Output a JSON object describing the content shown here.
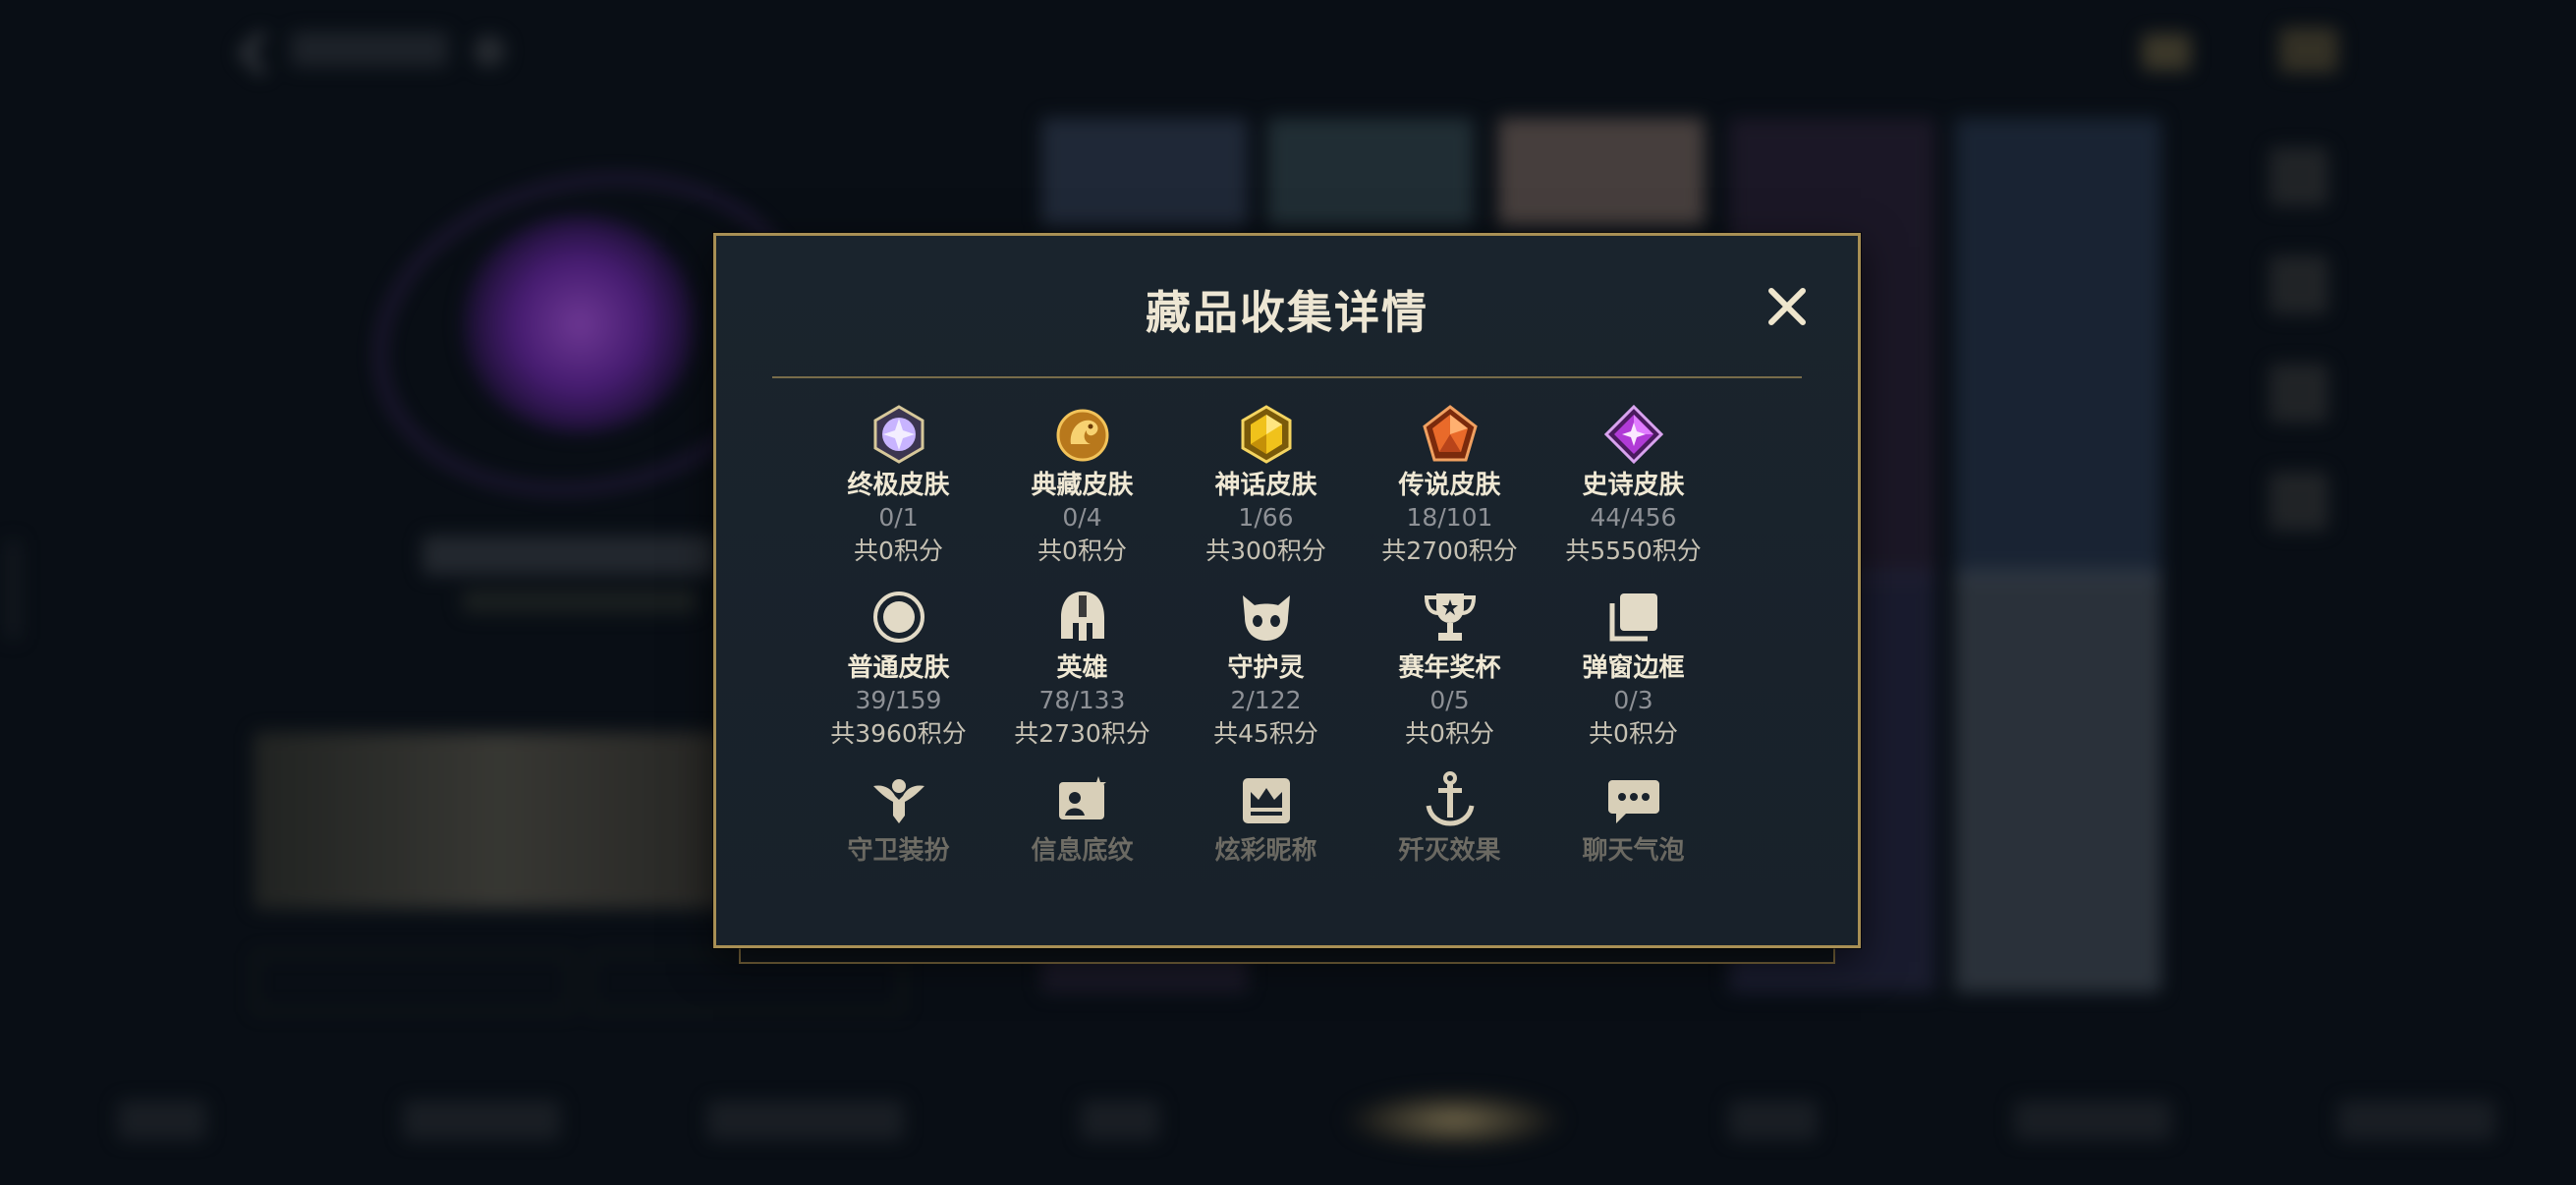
{
  "dialog": {
    "title": "藏品收集详情",
    "close_label": "✕"
  },
  "categories": [
    {
      "name": "终极皮肤",
      "count": "0/1",
      "points": "共0积分",
      "icon": "ultimate-skin-icon",
      "color": "#c8b4ff"
    },
    {
      "name": "典藏皮肤",
      "count": "0/4",
      "points": "共0积分",
      "icon": "collector-skin-icon",
      "color": "#e0a33a"
    },
    {
      "name": "神话皮肤",
      "count": "1/66",
      "points": "共300积分",
      "icon": "mythic-skin-icon",
      "color": "#f0c21b"
    },
    {
      "name": "传说皮肤",
      "count": "18/101",
      "points": "共2700积分",
      "icon": "legendary-skin-icon",
      "color": "#e96a2a"
    },
    {
      "name": "史诗皮肤",
      "count": "44/456",
      "points": "共5550积分",
      "icon": "epic-skin-icon",
      "color": "#b03ad6"
    },
    {
      "name": "普通皮肤",
      "count": "39/159",
      "points": "共3960积分",
      "icon": "normal-skin-icon",
      "color": "#d8cfb8"
    },
    {
      "name": "英雄",
      "count": "78/133",
      "points": "共2730积分",
      "icon": "hero-helmet-icon",
      "color": "#d8cfb8"
    },
    {
      "name": "守护灵",
      "count": "2/122",
      "points": "共45积分",
      "icon": "guardian-spirit-icon",
      "color": "#d8cfb8"
    },
    {
      "name": "赛年奖杯",
      "count": "0/5",
      "points": "共0积分",
      "icon": "trophy-icon",
      "color": "#d8cfb8"
    },
    {
      "name": "弹窗边框",
      "count": "0/3",
      "points": "共0积分",
      "icon": "popup-frame-icon",
      "color": "#d8cfb8"
    },
    {
      "name": "守卫装扮",
      "icon": "ward-skin-icon",
      "color": "#d8cfb8"
    },
    {
      "name": "信息底纹",
      "icon": "info-card-icon",
      "color": "#d8cfb8"
    },
    {
      "name": "炫彩昵称",
      "icon": "colorful-nickname-icon",
      "color": "#d8cfb8"
    },
    {
      "name": "歼灭效果",
      "icon": "annihilation-effect-icon",
      "color": "#d8cfb8"
    },
    {
      "name": "聊天气泡",
      "icon": "chat-bubble-icon",
      "color": "#d8cfb8"
    }
  ],
  "colors": {
    "accent_gold": "#a88f54",
    "panel_bg": "#1a242d"
  }
}
